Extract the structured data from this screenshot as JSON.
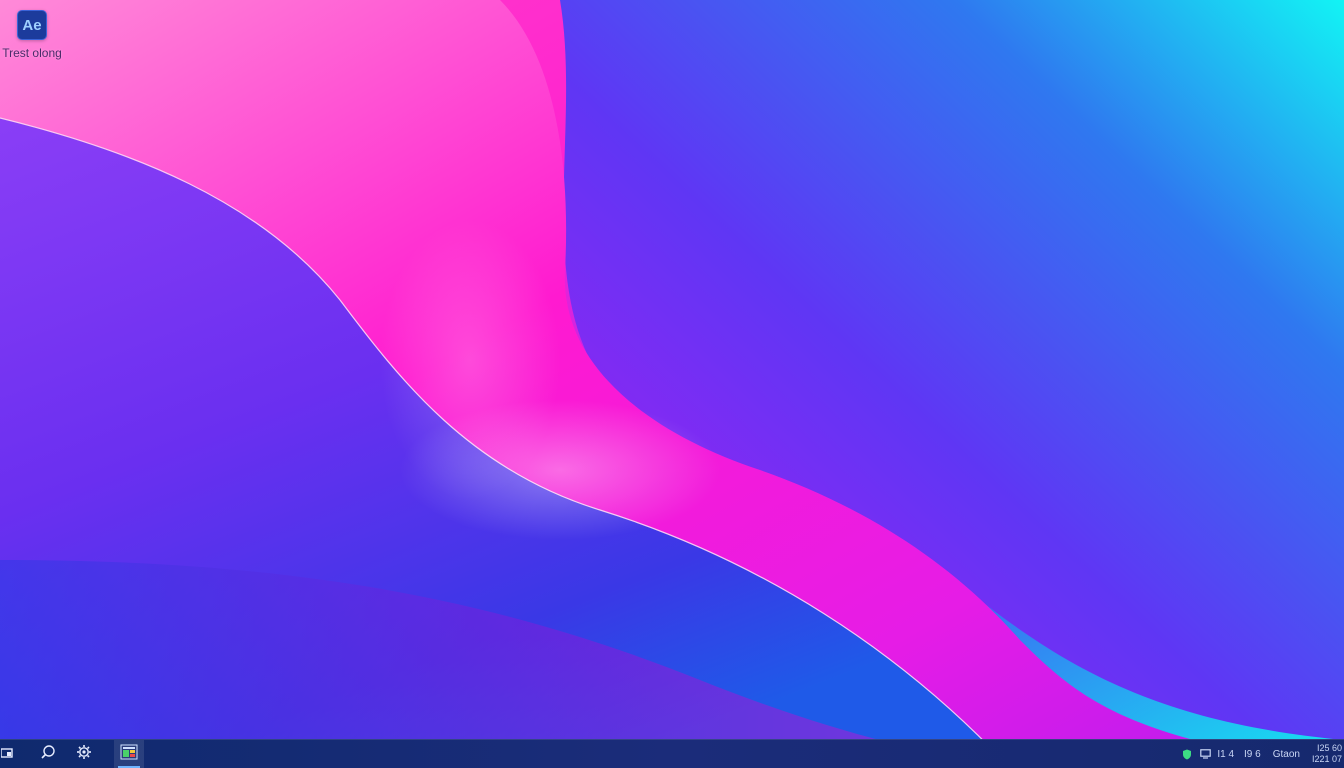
{
  "desktop": {
    "icons": [
      {
        "glyph": "Ae",
        "label": "Trest olong",
        "icon": "after-effects-icon"
      }
    ]
  },
  "taskbar": {
    "start_icon": "start-icon",
    "search_icon": "search-icon",
    "settings_icon": "settings-icon",
    "pinned_app_icon": "app-icon",
    "tray": {
      "shield_icon": "shield-icon",
      "monitor_icon": "monitor-icon",
      "text1": "I1 4",
      "text2": "I9 6",
      "text3": "Gtaon",
      "clock_line1": "I25 60",
      "clock_line2": "I221 07"
    }
  },
  "colors": {
    "icon_tile": "#1c3b9c",
    "icon_glyph": "#9fd0ff",
    "taskbar": "#14286e",
    "shield_green": "#3ddc84"
  }
}
